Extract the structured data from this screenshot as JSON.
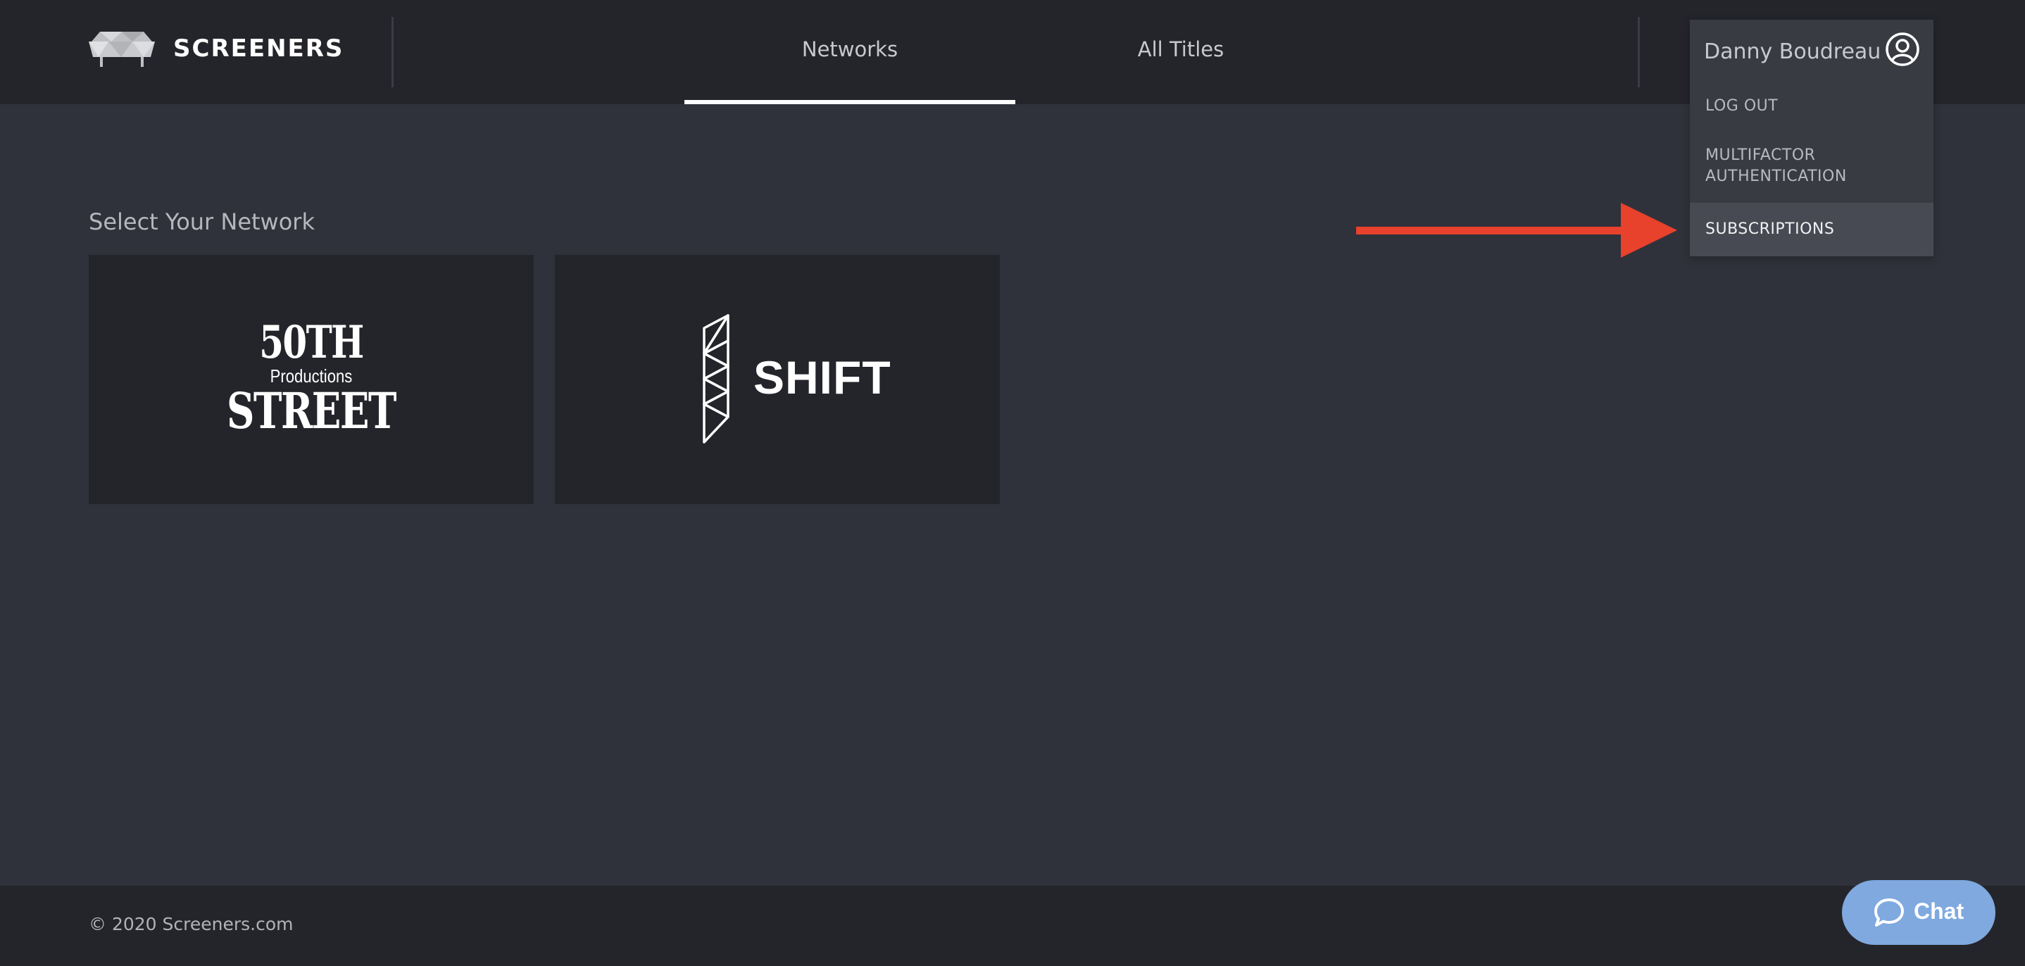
{
  "header": {
    "brand": "SCREENERS",
    "tabs": [
      {
        "label": "Networks",
        "active": true
      },
      {
        "label": "All Titles",
        "active": false
      }
    ]
  },
  "user_menu": {
    "user_name": "Danny Boudreau",
    "items": [
      {
        "label": "LOG OUT"
      },
      {
        "label": "MULTIFACTOR\nAUTHENTICATION"
      },
      {
        "label": "SUBSCRIPTIONS",
        "highlighted": true
      }
    ]
  },
  "main": {
    "section_title": "Select Your Network",
    "networks": [
      {
        "logo_lines": [
          "50TH",
          "Productions",
          "STREET"
        ]
      },
      {
        "logo_text": "SHIFT"
      }
    ]
  },
  "footer": {
    "copyright": "© 2020 Screeners.com"
  },
  "chat": {
    "label": "Chat"
  },
  "colors": {
    "header_bg": "#24252b",
    "page_bg": "#30323b",
    "arrow": "#e8412c",
    "chat_bg": "#7fa9df"
  },
  "icons": {
    "logo": "sofa-logo-icon",
    "user": "user-circle-icon",
    "arrow": "red-arrow",
    "chat": "chat-bubble-icon",
    "shift": "shift-geometric-logo"
  }
}
